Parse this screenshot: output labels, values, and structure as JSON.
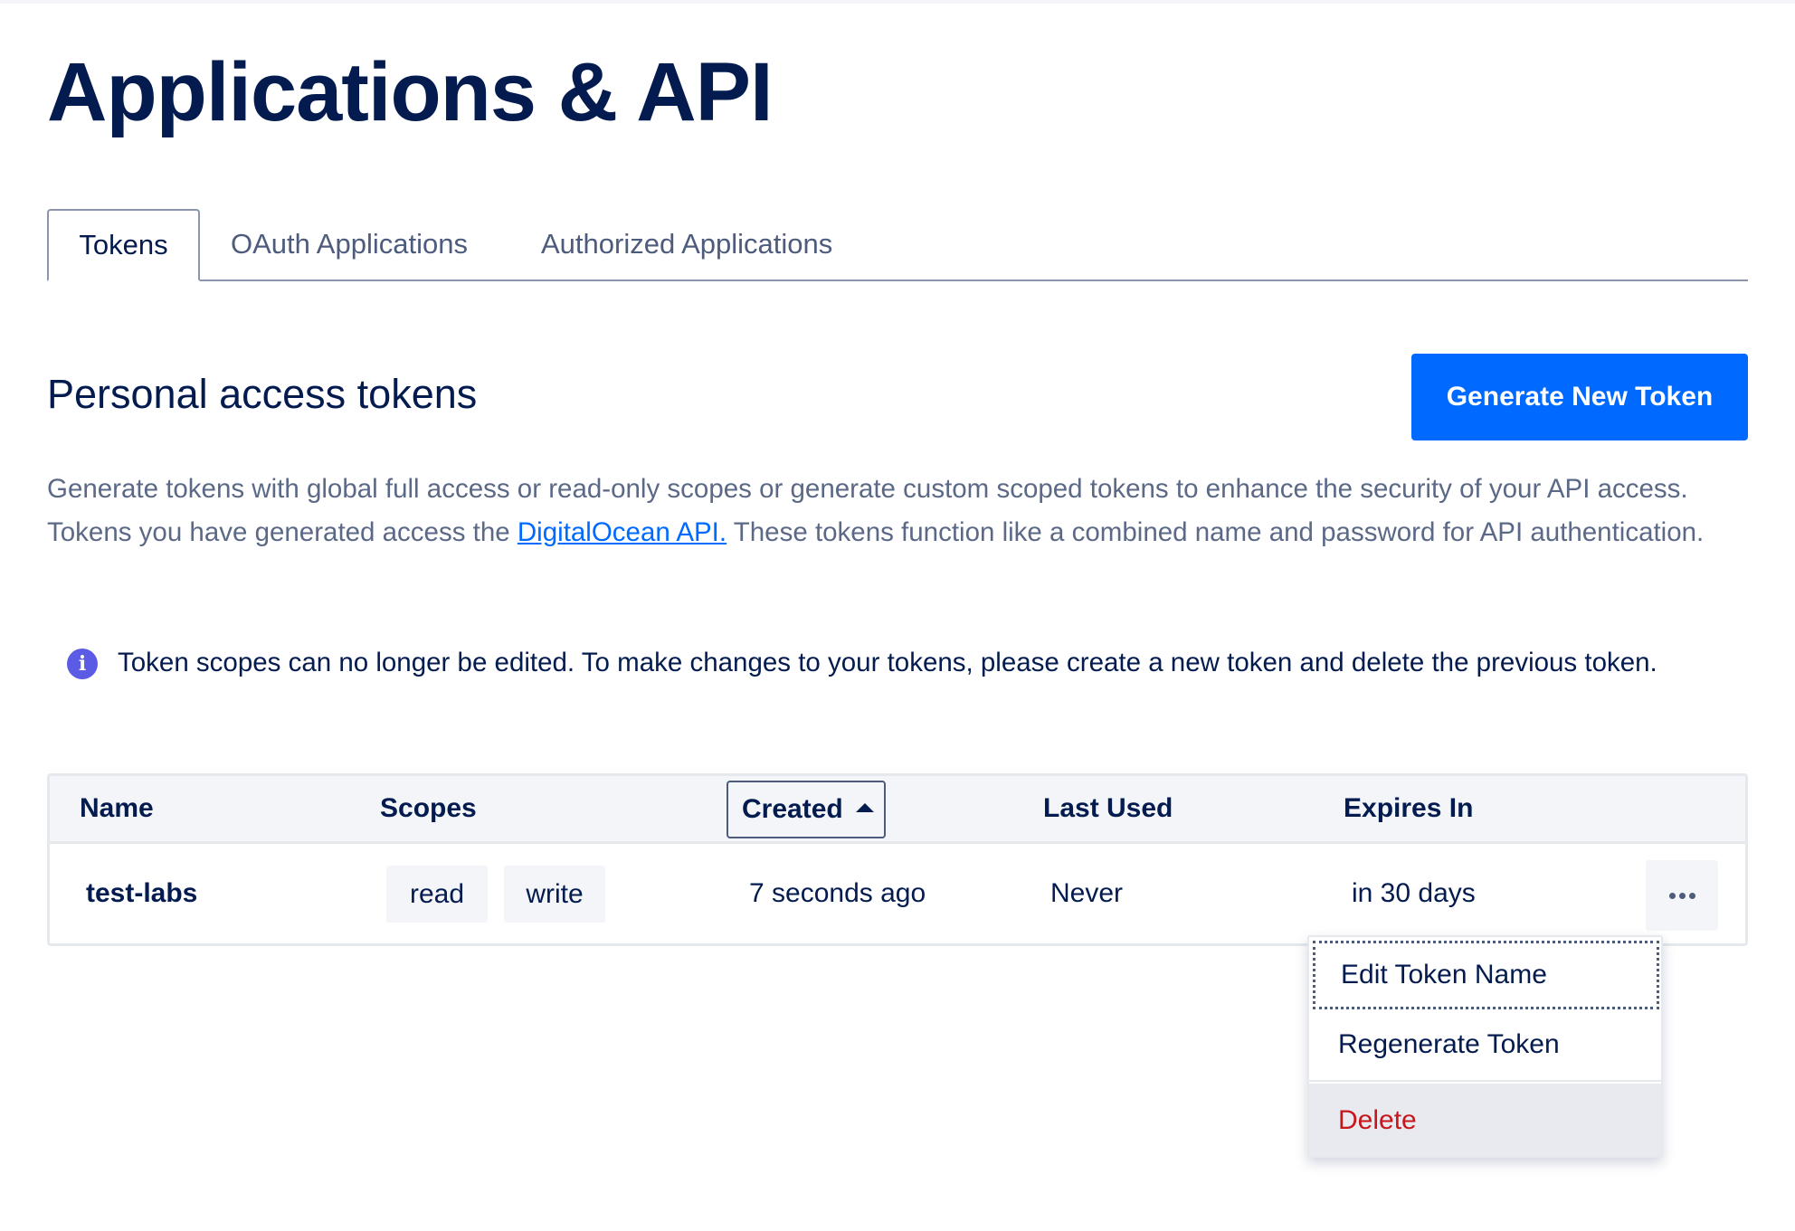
{
  "page": {
    "title": "Applications & API"
  },
  "tabs": [
    {
      "label": "Tokens",
      "active": true
    },
    {
      "label": "OAuth Applications",
      "active": false
    },
    {
      "label": "Authorized Applications",
      "active": false
    }
  ],
  "section": {
    "title": "Personal access tokens",
    "generate_button": "Generate New Token",
    "description_before_link": "Generate tokens with global full access or read-only scopes or generate custom scoped tokens to enhance the security of your API access. Tokens you have generated access the ",
    "description_link": "DigitalOcean API.",
    "description_after_link": " These tokens function like a combined name and password for API authentication."
  },
  "notice": {
    "icon": "info-icon",
    "text": "Token scopes can no longer be edited. To make changes to your tokens, please create a new token and delete the previous token."
  },
  "table": {
    "columns": [
      "Name",
      "Scopes",
      "Created",
      "Last Used",
      "Expires In"
    ],
    "sorted_by": "Created",
    "sort_direction": "ascending",
    "rows": [
      {
        "name": "test-labs",
        "scopes": [
          "read",
          "write"
        ],
        "created": "7 seconds ago",
        "last_used": "Never",
        "expires_in": "in 30 days",
        "actions_icon": "more-horizontal-icon"
      }
    ]
  },
  "row_menu": {
    "items": [
      {
        "label": "Edit Token Name",
        "focused": true
      },
      {
        "label": "Regenerate Token",
        "focused": false
      },
      {
        "label": "Delete",
        "hovered": true,
        "danger": true
      }
    ]
  },
  "colors": {
    "primary": "#0069ff",
    "heading": "#031b4e",
    "muted_text": "#5b6987",
    "info": "#5b5be6",
    "danger": "#c8161d"
  }
}
